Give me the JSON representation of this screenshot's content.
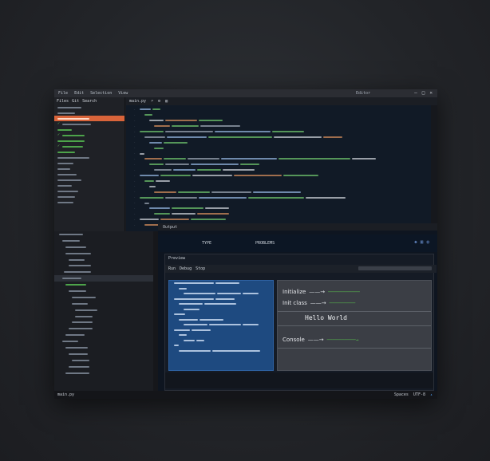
{
  "window": {
    "title": "Editor",
    "menu": [
      "File",
      "Edit",
      "Selection",
      "View"
    ],
    "controls": [
      "—",
      "□",
      "✕"
    ]
  },
  "sidebar": {
    "tabs": [
      "Files",
      "Git",
      "Search"
    ]
  },
  "editor": {
    "tab_label": "main.py",
    "tab_icons": [
      "search-icon",
      "gear-icon",
      "split-icon"
    ]
  },
  "panel": {
    "tab_label": "Output",
    "header_label": "TYPE",
    "header_mid": "PROBLEMS"
  },
  "inner": {
    "title": "Preview",
    "tools": [
      "Run",
      "Debug",
      "Stop"
    ],
    "hello": "Hello World",
    "row1_label": "Initialize",
    "row2_label": "Init class",
    "row3_label": "Console"
  },
  "statusbar": {
    "left": "main.py",
    "right": [
      "Spaces",
      "UTF-8"
    ]
  },
  "colors": {
    "accent": "#d9643a",
    "green": "#59c04e",
    "blue_pane": "#1e4a80"
  }
}
